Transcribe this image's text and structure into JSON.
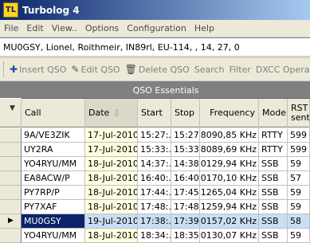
{
  "window": {
    "title": "Turbolog 4",
    "icon_label": "TL"
  },
  "menu": [
    "File",
    "Edit",
    "View..",
    "Options",
    "Configuration",
    "Help"
  ],
  "station_info": "MU0GSY, Lionel, Roithmeir, IN89rl, EU-114, , 14, 27, 0",
  "toolbar": [
    {
      "label": "Insert QSO",
      "icon": "insert-icon"
    },
    {
      "label": "Edit QSO",
      "icon": "edit-icon"
    },
    {
      "label": "Delete QSO",
      "icon": "trash-icon"
    },
    {
      "label": "Search",
      "icon": ""
    },
    {
      "label": "Filter",
      "icon": ""
    },
    {
      "label": "DXCC Operati",
      "icon": ""
    }
  ],
  "grid": {
    "group_title": "QSO Essentials",
    "columns": [
      "Call",
      "Date",
      "Start",
      "Stop",
      "Frequency",
      "Mode",
      "RST sent"
    ],
    "rst_sent_line1": "RST",
    "rst_sent_line2": "sent",
    "sorted_column": "Date",
    "rows": [
      [
        "9A/VE3ZIK",
        "17-Jul-2010",
        "15:27:...",
        "15:27...",
        "28090,85 KHz",
        "RTTY",
        "599"
      ],
      [
        "UY2RA",
        "17-Jul-2010",
        "15:33:...",
        "15:33...",
        "28089,69 KHz",
        "RTTY",
        "599"
      ],
      [
        "YO4RYU/MM",
        "18-Jul-2010",
        "14:37:...",
        "14:38...",
        "50129,94 KHz",
        "SSB",
        "59"
      ],
      [
        "EA8ACW/P",
        "18-Jul-2010",
        "16:40:...",
        "16:40...",
        "50170,10 KHz",
        "SSB",
        "57"
      ],
      [
        "PY7RP/P",
        "18-Jul-2010",
        "17:44:...",
        "17:45...",
        "21265,04 KHz",
        "SSB",
        "59"
      ],
      [
        "PY7XAF",
        "18-Jul-2010",
        "17:48:...",
        "17:48...",
        "21259,94 KHz",
        "SSB",
        "59"
      ],
      [
        "MU0GSY",
        "19-Jul-2010",
        "17:38:...",
        "17:39...",
        "50157,02 KHz",
        "SSB",
        "58"
      ],
      [
        "YO4RYU/MM",
        "18-Jul-2010",
        "18:34:...",
        "18:35...",
        "50130,07 KHz",
        "SSB",
        "59"
      ]
    ],
    "selected_row": 6
  }
}
